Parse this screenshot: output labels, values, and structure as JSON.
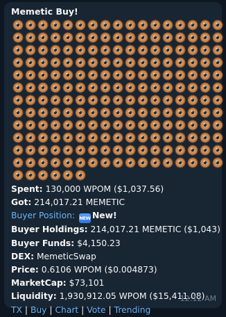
{
  "message": {
    "title": "Memetic Buy!",
    "donut_count": 210,
    "spent_label": "Spent:",
    "spent_value": "130,000 WPOM ($1,037.56)",
    "got_label": "Got:",
    "got_value": "214,017.21 MEMETIC",
    "buyer_position_label": "Buyer Position:",
    "new_badge": "NEW",
    "new_text": "New!",
    "holdings_label": "Buyer Holdings:",
    "holdings_value": "214,017.21 MEMETIC ($1,043)",
    "funds_label": "Buyer Funds:",
    "funds_value": "$4,150.23",
    "dex_label": "DEX:",
    "dex_value": "MemeticSwap",
    "price_label": "Price:",
    "price_value": "0.6106 WPOM ($0.004873)",
    "marketcap_label": "MarketCap:",
    "marketcap_value": "$73,101",
    "liquidity_label": "Liquidity:",
    "liquidity_value": "1,930,912.05 WPOM ($15,411.08)",
    "links": {
      "tx": "TX",
      "buy": "Buy",
      "chart": "Chart",
      "vote": "Vote",
      "trending": "Trending"
    },
    "separator": "|",
    "time": "12:12 AM"
  },
  "colors": {
    "background": "#0e1621",
    "bubble": "#182533",
    "text": "#f5f5f5",
    "link": "#6ab3f3",
    "time": "#6d7f8f"
  },
  "icons": {
    "donut": "doughnut-emoji",
    "new_badge": "new-button-emoji"
  }
}
